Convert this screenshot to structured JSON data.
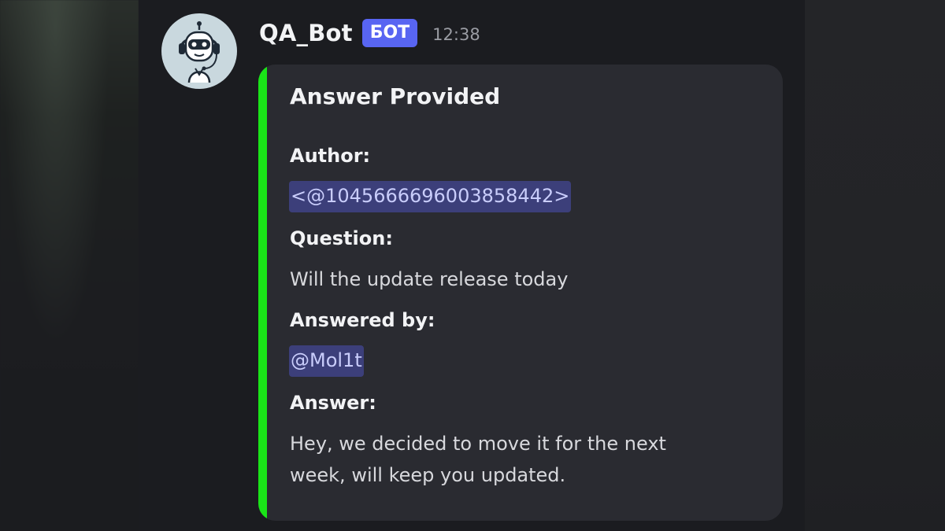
{
  "message": {
    "username": "QA_Bot",
    "badge": "БОТ",
    "timestamp": "12:38",
    "avatar_icon": "robot-headset-icon"
  },
  "embed": {
    "accent_color": "#1ae418",
    "title": "Answer Provided",
    "fields": [
      {
        "name": "Author:",
        "value": "<@1045666696003858442>",
        "is_mention": true
      },
      {
        "name": "Question:",
        "value": "Will the update release today",
        "is_mention": false
      },
      {
        "name": "Answered by:",
        "value": "@Mol1t",
        "is_mention": true
      },
      {
        "name": "Answer:",
        "value_lines": [
          "Hey, we decided to move it for the next",
          "week, will keep you updated."
        ],
        "is_mention": false
      }
    ]
  },
  "colors": {
    "badge": "#5865f2",
    "mention_bg": "#3c3f7a",
    "mention_text": "#c9cdfb",
    "embed_bg": "#2a2b31"
  }
}
